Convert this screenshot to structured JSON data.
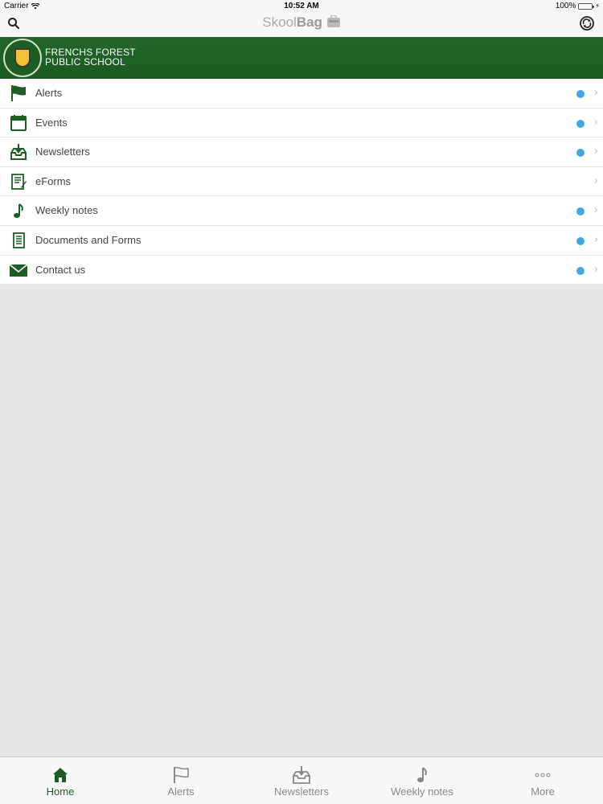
{
  "status_bar": {
    "carrier": "Carrier",
    "time": "10:52 AM",
    "battery": "100%"
  },
  "nav": {
    "brand_light": "Skool",
    "brand_bold": "Bag"
  },
  "banner": {
    "line1": "FRENCHS FOREST",
    "line2": "PUBLIC SCHOOL"
  },
  "menu": {
    "items": [
      {
        "label": "Alerts",
        "icon": "flag-icon",
        "has_dot": true
      },
      {
        "label": "Events",
        "icon": "calendar-icon",
        "has_dot": true
      },
      {
        "label": "Newsletters",
        "icon": "inbox-download-icon",
        "has_dot": true
      },
      {
        "label": "eForms",
        "icon": "form-icon",
        "has_dot": false
      },
      {
        "label": "Weekly notes",
        "icon": "music-note-icon",
        "has_dot": true
      },
      {
        "label": "Documents and Forms",
        "icon": "document-icon",
        "has_dot": true
      },
      {
        "label": "Contact us",
        "icon": "envelope-icon",
        "has_dot": true
      }
    ]
  },
  "tabs": [
    {
      "label": "Home",
      "icon": "home-icon",
      "active": true
    },
    {
      "label": "Alerts",
      "icon": "flag-icon",
      "active": false
    },
    {
      "label": "Newsletters",
      "icon": "inbox-download-icon",
      "active": false
    },
    {
      "label": "Weekly notes",
      "icon": "music-note-icon",
      "active": false
    },
    {
      "label": "More",
      "icon": "more-dots-icon",
      "active": false
    }
  ],
  "colors": {
    "brand_green": "#1e5e25",
    "dot_blue": "#3fa9e0",
    "tab_inactive": "#888888"
  }
}
